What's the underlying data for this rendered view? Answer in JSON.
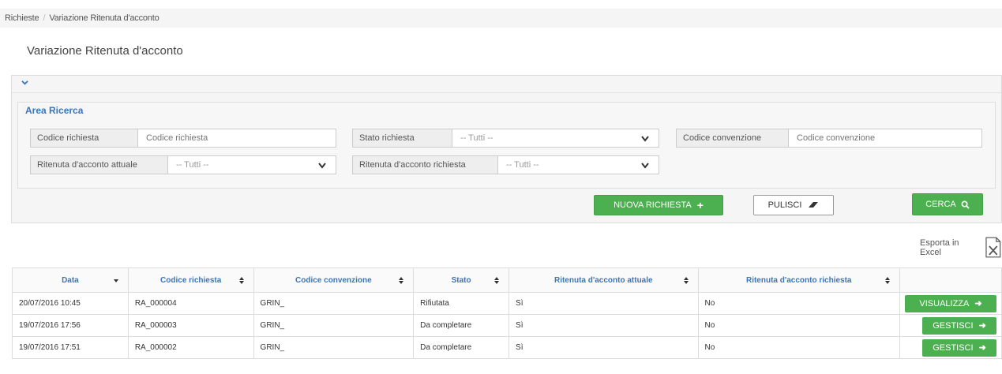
{
  "breadcrumb": {
    "items": [
      "Richieste",
      "Variazione Ritenuta d'acconto"
    ]
  },
  "page": {
    "title": "Variazione Ritenuta d'acconto"
  },
  "search": {
    "area_title": "Area Ricerca",
    "codice_richiesta": {
      "label": "Codice richiesta",
      "placeholder": "Codice richiesta"
    },
    "stato_richiesta": {
      "label": "Stato richiesta",
      "value": "-- Tutti --"
    },
    "codice_convenzione": {
      "label": "Codice convenzione",
      "placeholder": "Codice convenzione"
    },
    "ritenuta_attuale": {
      "label": "Ritenuta d'acconto attuale",
      "value": "-- Tutti --"
    },
    "ritenuta_richiesta": {
      "label": "Ritenuta d'acconto richiesta",
      "value": "-- Tutti --"
    }
  },
  "actions": {
    "nuova": "NUOVA RICHIESTA",
    "pulisci": "PULISCI",
    "cerca": "CERCA"
  },
  "export": {
    "label": "Esporta in Excel"
  },
  "table": {
    "headers": [
      "Data",
      "Codice richiesta",
      "Codice convenzione",
      "Stato",
      "Ritenuta d'acconto attuale",
      "Ritenuta d'acconto richiesta"
    ],
    "rows": [
      {
        "data": "20/07/2016 10:45",
        "codice": "RA_000004",
        "convenzione": "GRIN_",
        "stato": "Rifiutata",
        "attuale": "Sì",
        "richiesta": "No",
        "action": "VISUALIZZA"
      },
      {
        "data": "19/07/2016 17:56",
        "codice": "RA_000003",
        "convenzione": "GRIN_",
        "stato": "Da completare",
        "attuale": "Sì",
        "richiesta": "No",
        "action": "GESTISCI"
      },
      {
        "data": "19/07/2016 17:51",
        "codice": "RA_000002",
        "convenzione": "GRIN_",
        "stato": "Da completare",
        "attuale": "Sì",
        "richiesta": "No",
        "action": "GESTISCI"
      }
    ]
  },
  "colors": {
    "accent": "#3a76b8",
    "green": "#4caf50"
  }
}
